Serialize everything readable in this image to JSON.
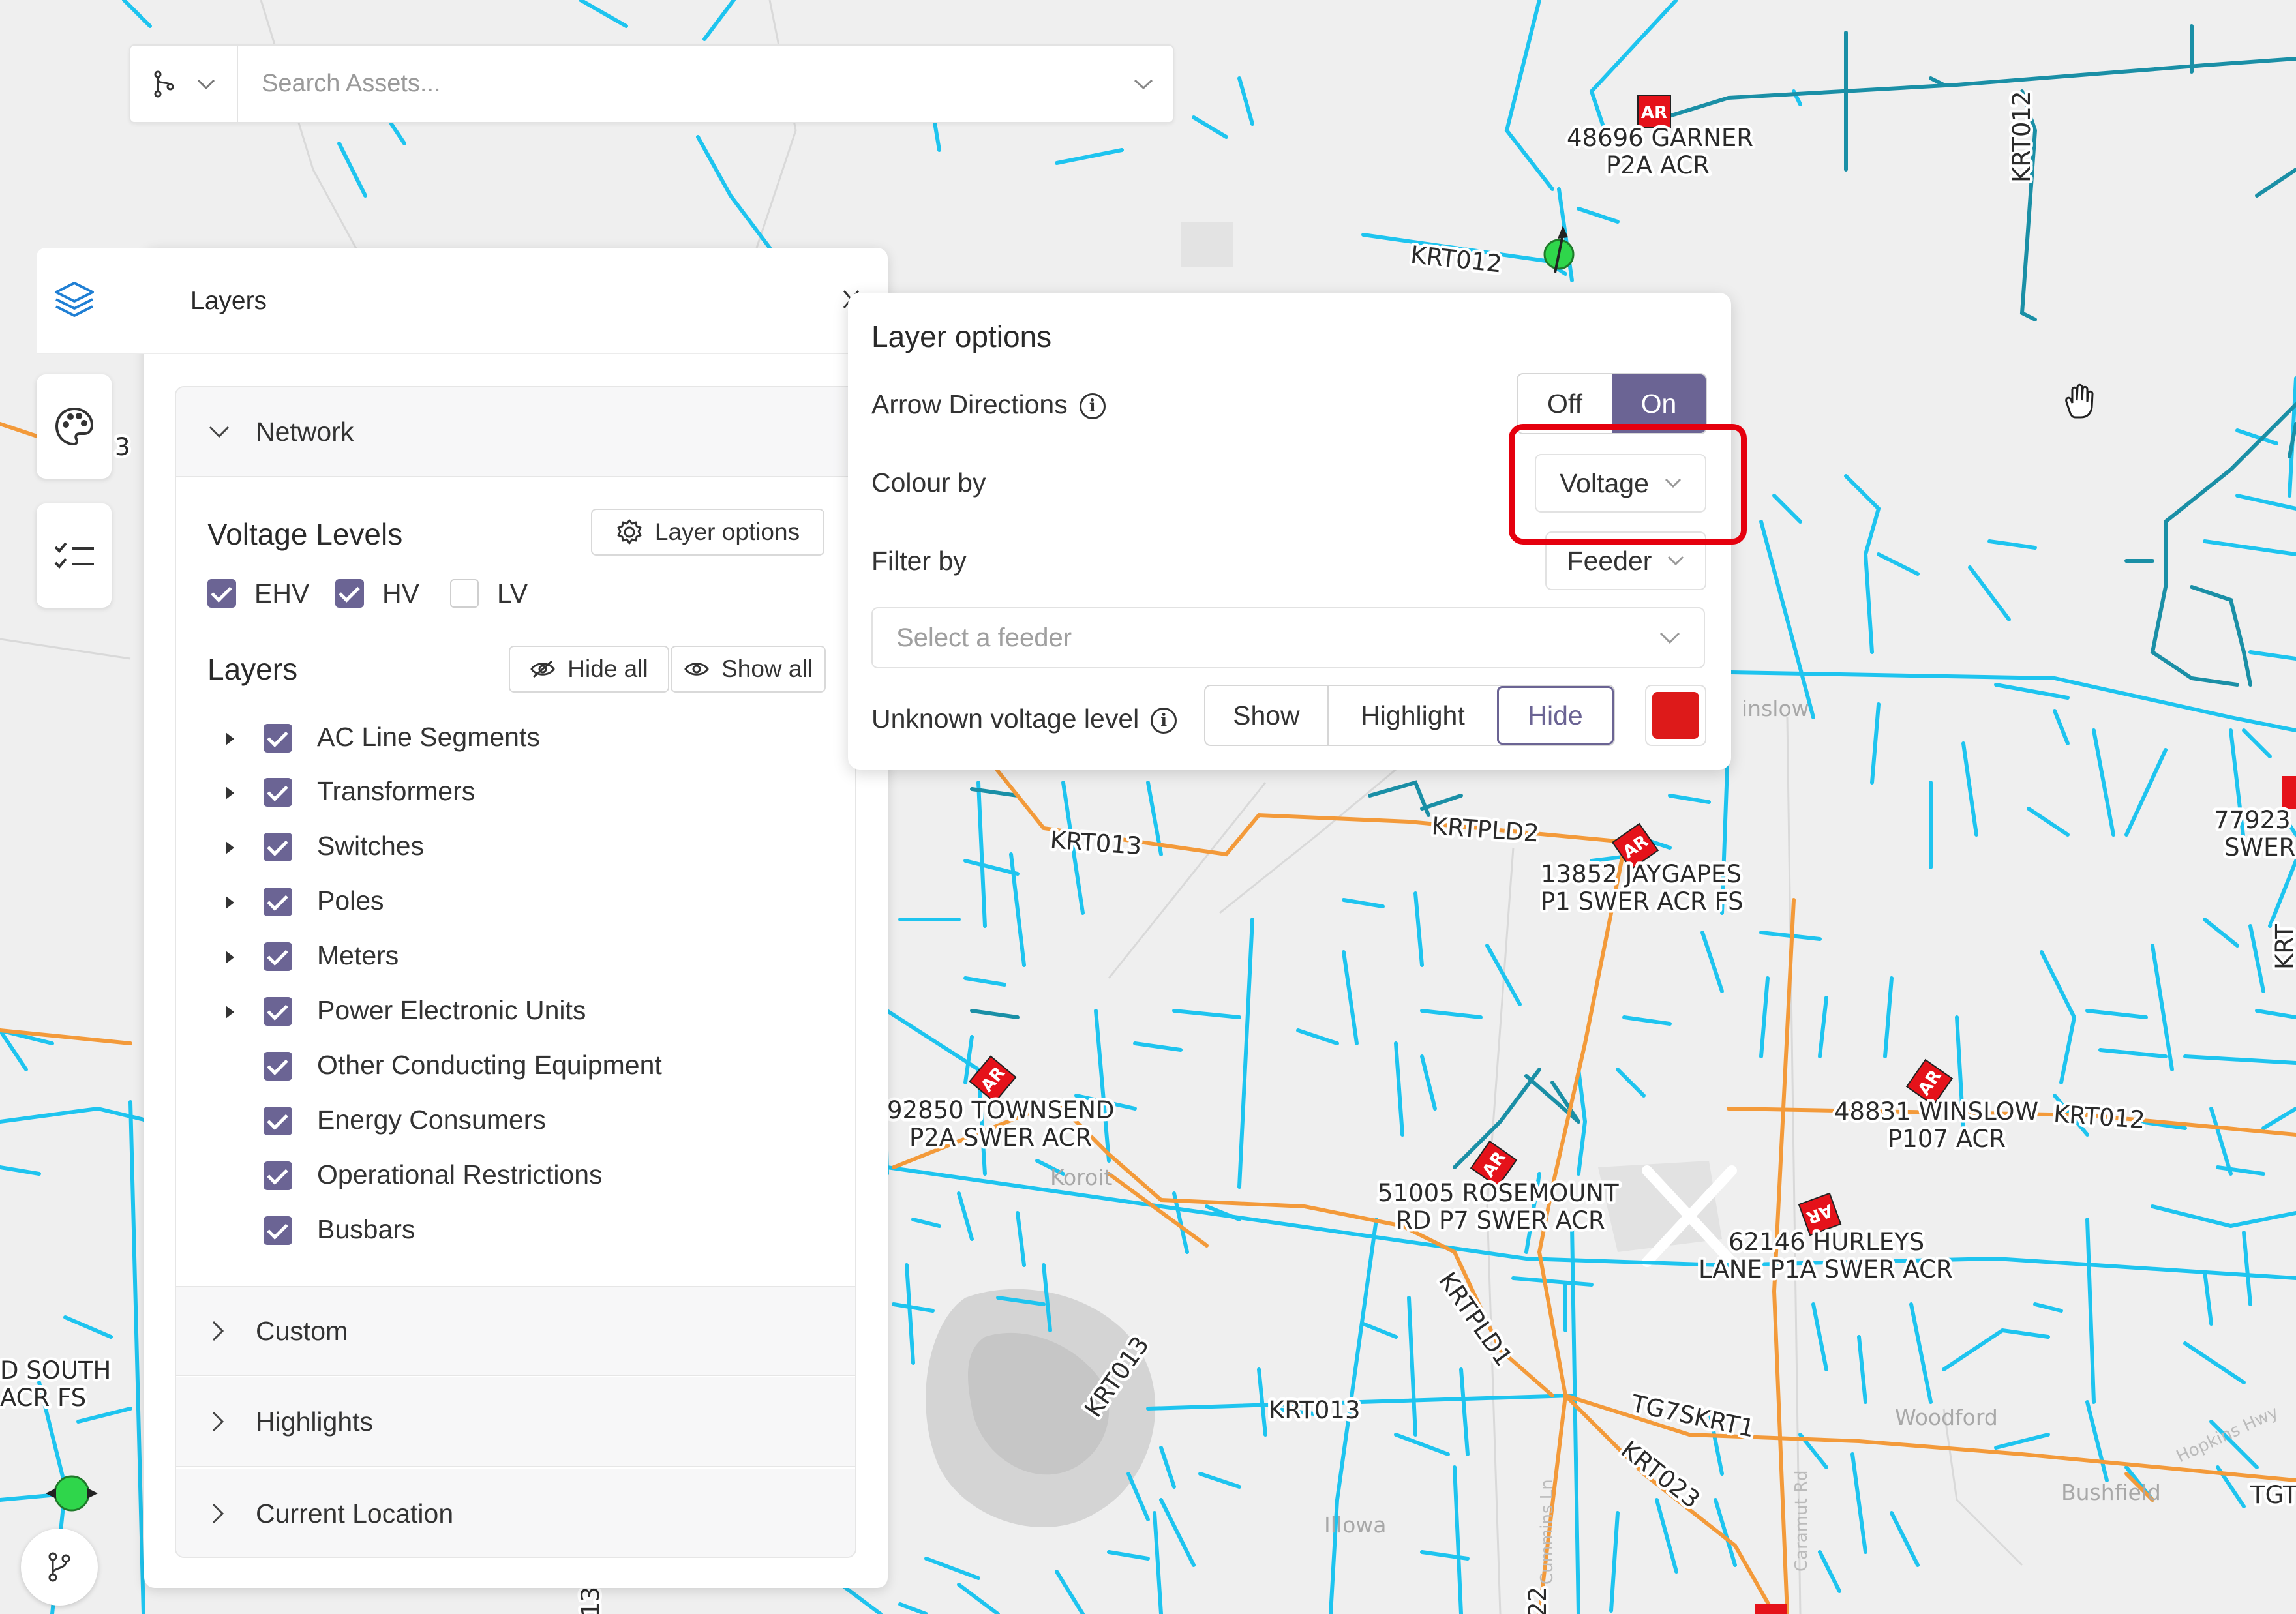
{
  "colors": {
    "accent": "#6b6494",
    "hv_line": "#1ec4ef",
    "ehv_line": "#1a8fa6",
    "feeder_line": "#f39a3a",
    "recloser_red": "#e5121a",
    "unknown_voltage_swatch": "#dd1a1a",
    "highlight_box": "#e5000e"
  },
  "search": {
    "placeholder": "Search Assets...",
    "mode_icon": "branch-icon"
  },
  "rail": {
    "layers_icon": "layers-icon",
    "palette_icon": "palette-icon",
    "checklist_icon": "checklist-icon",
    "branch_fab_icon": "git-branch-icon"
  },
  "layers_panel": {
    "title": "Layers",
    "close_icon": "close-icon",
    "network": {
      "label": "Network",
      "voltage_levels": {
        "title": "Voltage Levels",
        "layer_options_label": "Layer options",
        "items": [
          {
            "label": "EHV",
            "checked": true
          },
          {
            "label": "HV",
            "checked": true
          },
          {
            "label": "LV",
            "checked": false
          }
        ]
      },
      "layers": {
        "title": "Layers",
        "hide_all": "Hide all",
        "show_all": "Show all",
        "items": [
          {
            "label": "AC Line Segments",
            "checked": true,
            "expandable": true
          },
          {
            "label": "Transformers",
            "checked": true,
            "expandable": true
          },
          {
            "label": "Switches",
            "checked": true,
            "expandable": true
          },
          {
            "label": "Poles",
            "checked": true,
            "expandable": true
          },
          {
            "label": "Meters",
            "checked": true,
            "expandable": true
          },
          {
            "label": "Power Electronic Units",
            "checked": true,
            "expandable": true
          },
          {
            "label": "Other Conducting Equipment",
            "checked": true,
            "expandable": false
          },
          {
            "label": "Energy Consumers",
            "checked": true,
            "expandable": false
          },
          {
            "label": "Operational Restrictions",
            "checked": true,
            "expandable": false
          },
          {
            "label": "Busbars",
            "checked": true,
            "expandable": false
          }
        ]
      }
    },
    "sections": [
      "Custom",
      "Highlights",
      "Current Location"
    ]
  },
  "layer_options": {
    "title": "Layer options",
    "arrow_directions": {
      "label": "Arrow Directions",
      "off": "Off",
      "on": "On",
      "selected": "On"
    },
    "colour_by": {
      "label": "Colour by",
      "value": "Voltage"
    },
    "filter_by": {
      "label": "Filter by",
      "value": "Feeder"
    },
    "feeder_select": {
      "placeholder": "Select a feeder"
    },
    "unknown_voltage": {
      "label": "Unknown voltage level",
      "options": [
        "Show",
        "Highlight",
        "Hide"
      ],
      "selected": "Hide"
    }
  },
  "map": {
    "feeder_labels": [
      "KRT012",
      "KRT013",
      "KRTPLD2",
      "KRTPLD1",
      "KRT023",
      "TG7SKRT1",
      "TGT",
      "KRT012",
      "KRT012",
      "KRT013",
      "KRT013"
    ],
    "devices": [
      {
        "badge": "AR",
        "line1": "48696 GARNER",
        "line2": "P2A ACR"
      },
      {
        "badge": "AR",
        "line1": "13852 JAYGAPES",
        "line2": "P1 SWER ACR FS"
      },
      {
        "badge": "AR",
        "line1": "92850 TOWNSEND",
        "line2": "P2A SWER ACR"
      },
      {
        "badge": "AR",
        "line1": "51005 ROSEMOUNT",
        "line2": "RD P7 SWER ACR"
      },
      {
        "badge": "AR",
        "line1": "48831 WINSLOW",
        "line2": "P107 ACR"
      },
      {
        "badge": "AR",
        "line1": "62146 HURLEYS",
        "line2": "LANE P1A SWER ACR"
      },
      {
        "badge": "",
        "line1": "77923",
        "line2": "SWER"
      },
      {
        "badge": "",
        "line1": "D SOUTH",
        "line2": "ACR FS"
      }
    ],
    "towns": [
      "Koroit",
      "Woodford",
      "Bushfield",
      "inslow",
      "Illowa"
    ],
    "roads": [
      "Hopkins Hwy",
      "Cummins Ln",
      "Caramut Rd"
    ],
    "misc": [
      "3",
      "13",
      "22",
      "KRT"
    ]
  }
}
